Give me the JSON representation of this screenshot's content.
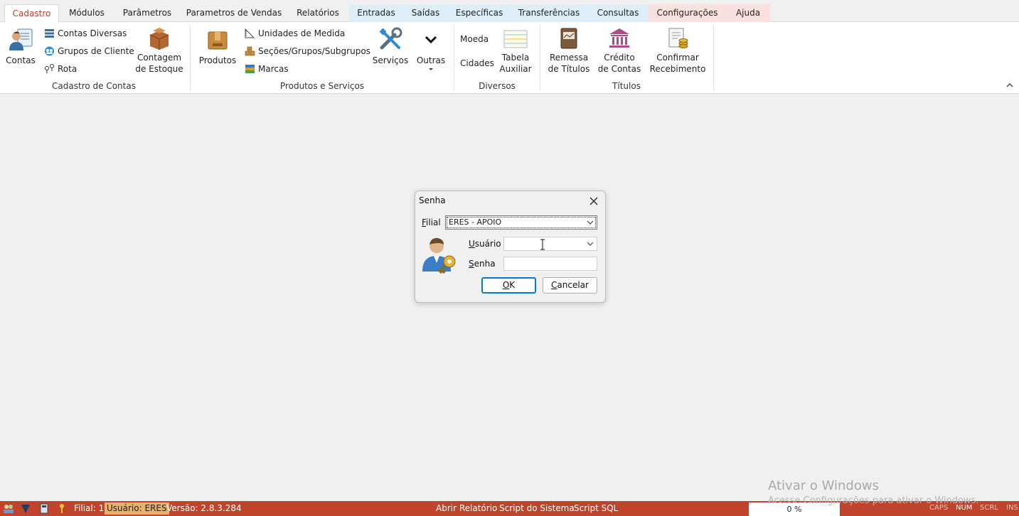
{
  "tabs": [
    {
      "label": "Cadastro"
    },
    {
      "label": "Módulos"
    },
    {
      "label": "Parâmetros"
    },
    {
      "label": "Parametros de Vendas"
    },
    {
      "label": "Relatórios"
    },
    {
      "label": "Entradas"
    },
    {
      "label": "Saídas"
    },
    {
      "label": "Específicas"
    },
    {
      "label": "Transferências"
    },
    {
      "label": "Consultas"
    },
    {
      "label": "Configurações"
    },
    {
      "label": "Ajuda"
    }
  ],
  "ribbon": {
    "cadastro_contas": {
      "group_label": "Cadastro de Contas",
      "contas": "Contas",
      "contas_diversas": "Contas Diversas",
      "grupos_cliente": "Grupos de Cliente",
      "rota": "Rota",
      "contagem_line1": "Contagem",
      "contagem_line2": "de Estoque"
    },
    "produtos_servicos": {
      "group_label": "Produtos e Serviços",
      "produtos": "Produtos",
      "unidades": "Unidades de Medida",
      "secoes": "Seções/Grupos/Subgrupos",
      "marcas": "Marcas",
      "servicos": "Serviços",
      "outras": "Outras"
    },
    "diversos": {
      "group_label": "Diversos",
      "moeda": "Moeda",
      "cidades": "Cidades",
      "tabela_line1": "Tabela",
      "tabela_line2": "Auxiliar"
    },
    "titulos": {
      "group_label": "Títulos",
      "remessa_line1": "Remessa",
      "remessa_line2": "de Títulos",
      "credito_line1": "Crédito",
      "credito_line2": "de Contas",
      "confirmar_line1": "Confirmar",
      "confirmar_line2": "Recebimento"
    }
  },
  "dialog": {
    "title": "Senha",
    "filial_label_first": "F",
    "filial_label_rest": "ilial",
    "filial_value": "ERES - APOIO",
    "usuario_label_first": "U",
    "usuario_label_rest": "suário",
    "usuario_value": "",
    "senha_label_first": "S",
    "senha_label_rest": "enha",
    "senha_value": "",
    "ok_first": "O",
    "ok_rest": "K",
    "cancel_first": "C",
    "cancel_rest": "ancelar"
  },
  "statusbar": {
    "filial": "Filial: 1",
    "usuario": "Usuário: ERES",
    "versao": "Versão: 2.8.3.284",
    "abrir_relatorio": "Abrir Relatório",
    "script_sistema": "Script do Sistema",
    "script_sql": "Script SQL",
    "progress": "0 %",
    "caps": "CAPS",
    "num": "NUM",
    "scrl": "SCRL",
    "ins": "INS"
  },
  "watermark": {
    "title": "Ativar o Windows",
    "subtitle": "Acesse Configurações para ativar o Windows."
  }
}
